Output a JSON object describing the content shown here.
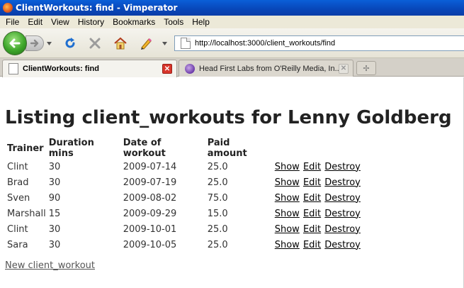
{
  "window": {
    "title": "ClientWorkouts: find - Vimperator"
  },
  "menubar": {
    "items": [
      "File",
      "Edit",
      "View",
      "History",
      "Bookmarks",
      "Tools",
      "Help"
    ]
  },
  "navbar": {
    "url": "http://localhost:3000/client_workouts/find"
  },
  "tabs": [
    {
      "label": "ClientWorkouts: find",
      "active": true
    },
    {
      "label": "Head First Labs from O'Reilly Media, In...",
      "active": false
    }
  ],
  "page": {
    "heading": "Listing client_workouts for Lenny Goldberg",
    "columns": [
      "Trainer",
      "Duration mins",
      "Date of workout",
      "Paid amount"
    ],
    "rows": [
      {
        "trainer": "Clint",
        "duration": "30",
        "date": "2009-07-14",
        "paid": "25.0"
      },
      {
        "trainer": "Brad",
        "duration": "30",
        "date": "2009-07-19",
        "paid": "25.0"
      },
      {
        "trainer": "Sven",
        "duration": "90",
        "date": "2009-08-02",
        "paid": "75.0"
      },
      {
        "trainer": "Marshall",
        "duration": "15",
        "date": "2009-09-29",
        "paid": "15.0"
      },
      {
        "trainer": "Clint",
        "duration": "30",
        "date": "2009-10-01",
        "paid": "25.0"
      },
      {
        "trainer": "Sara",
        "duration": "30",
        "date": "2009-10-05",
        "paid": "25.0"
      }
    ],
    "actions": {
      "show": "Show",
      "edit": "Edit",
      "destroy": "Destroy"
    },
    "new_link": "New client_workout"
  },
  "colors": {
    "titlebar": "#0846b8",
    "chrome": "#ece9d8",
    "tab_close": "#d8352b",
    "back_button": "#3da62a"
  }
}
